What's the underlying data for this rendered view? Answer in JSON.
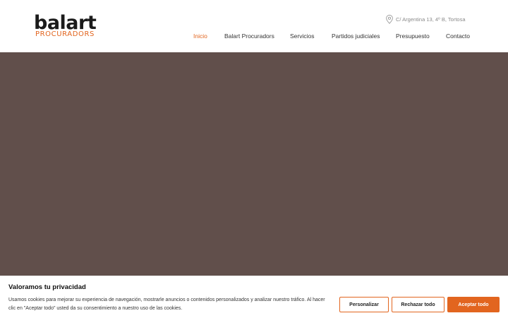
{
  "brand": {
    "name": "balart",
    "subtitle": "PROCURADORS",
    "accent": "#e2651f",
    "text_color": "#1b1b1b"
  },
  "header": {
    "address": "C/ Argentina 13, 4º B, Tortosa",
    "address_icon": "location-pin-icon"
  },
  "nav": {
    "items": [
      {
        "label": "Inicio",
        "active": true
      },
      {
        "label": "Balart Procuradors"
      },
      {
        "label": "Servicios"
      },
      {
        "label": "Partidos judiciales"
      },
      {
        "label": "Presupuesto"
      },
      {
        "label": "Contacto"
      }
    ]
  },
  "hero": {
    "background": "#614f4b"
  },
  "cookie_banner": {
    "title": "Valoramos tu privacidad",
    "text": "Usamos cookies para mejorar su experiencia de navegación, mostrarle anuncios o contenidos personalizados y analizar nuestro tráfico. Al hacer clic en \"Aceptar todo\" usted da su consentimiento a nuestro uso de las cookies.",
    "customize_label": "Personalizar",
    "reject_label": "Rechazar todo",
    "accept_label": "Aceptar todo"
  }
}
